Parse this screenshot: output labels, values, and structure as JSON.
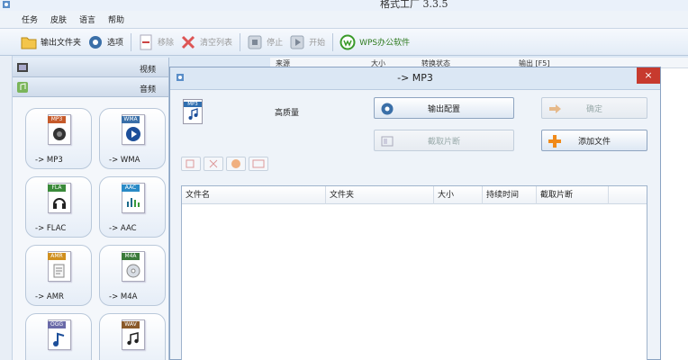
{
  "window": {
    "title": "格式工厂  3.3.5"
  },
  "menu": [
    "任务",
    "皮肤",
    "语言",
    "帮助"
  ],
  "toolbar": {
    "output_folder": "输出文件夹",
    "options": "选项",
    "remove": "移除",
    "clear_list": "清空列表",
    "stop": "停止",
    "start": "开始",
    "wps": "WPS办公软件"
  },
  "sidebar": {
    "video_label": "视频",
    "audio_label": "音频",
    "formats": [
      {
        "label": "-> MP3",
        "tag": "MP3",
        "icon": "speaker-icon"
      },
      {
        "label": "-> WMA",
        "tag": "WMA",
        "icon": "play-icon"
      },
      {
        "label": "-> FLAC",
        "tag": "FLA",
        "icon": "headphones-icon"
      },
      {
        "label": "-> AAC",
        "tag": "AAC",
        "icon": "waveform-icon"
      },
      {
        "label": "-> AMR",
        "tag": "AMR",
        "icon": "doc-icon"
      },
      {
        "label": "-> M4A",
        "tag": "M4A",
        "icon": "disc-icon"
      },
      {
        "label": "",
        "tag": "OGG",
        "icon": "note-icon"
      },
      {
        "label": "",
        "tag": "WAV",
        "icon": "notes-icon"
      }
    ]
  },
  "background_list": {
    "headers": [
      "来源",
      "大小",
      "转换状态",
      "输出 [F5]"
    ]
  },
  "dialog": {
    "title": "-> MP3",
    "close": "×",
    "format_tag": "MP3",
    "quality": "高质量",
    "output_config": "输出配置",
    "ok": "确定",
    "clip": "截取片断",
    "add_file": "添加文件",
    "table_headers": [
      "文件名",
      "文件夹",
      "大小",
      "持续时间",
      "截取片断"
    ]
  },
  "colors": {
    "accent": "#2f6fb0",
    "close_red": "#c73a2e",
    "wps_green": "#2d7a1d",
    "add_orange": "#f08a1a"
  }
}
